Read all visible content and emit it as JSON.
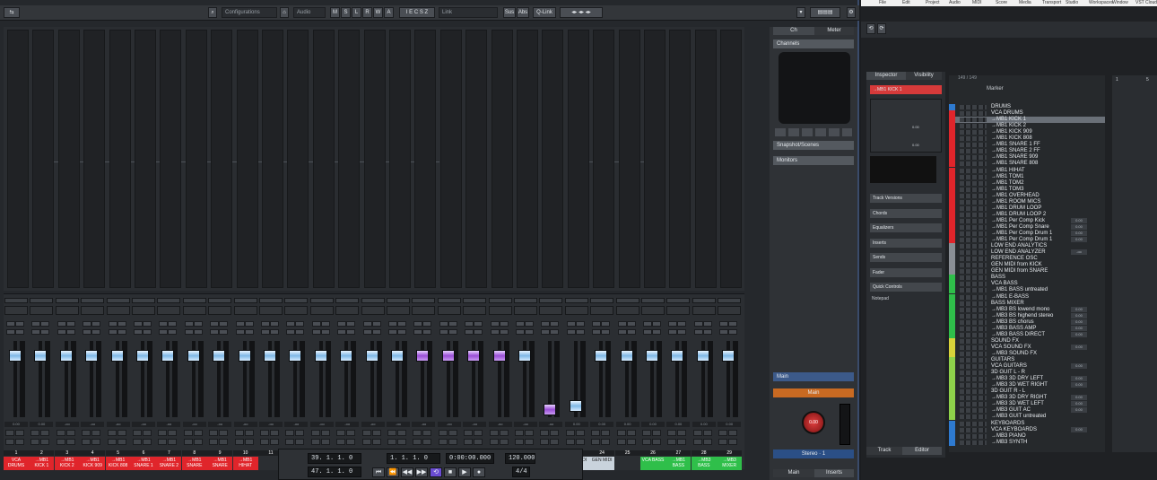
{
  "mixer": {
    "toolbar": {
      "config_label": "Configurations",
      "field_a": "Audio",
      "letters": [
        "M",
        "S",
        "L",
        "R",
        "W",
        "A"
      ],
      "field_b": "Link",
      "sus": "Sus",
      "abs": "Abs",
      "qlink": "Q-Link"
    },
    "right_panel": {
      "tab_ch": "Ch",
      "tab_meter": "Meter",
      "channel_label": "Channels",
      "snap_label": "Snapshot/Scenes",
      "monitors_label": "Monitors",
      "main_label": "Main",
      "main_value": "Main",
      "stereo": "Stereo",
      "stereo_value": "1",
      "knob_value": "0.00",
      "bottom_tab_main": "Main",
      "bottom_tab_inserts": "Inserts"
    },
    "strips": [
      {
        "num": "1",
        "name": "VCA DRUMS",
        "color": "#e0252b",
        "val": "0.00",
        "cap": "blue"
      },
      {
        "num": "2",
        "name": "→MB1 KICK 1",
        "color": "#e0252b",
        "val": "0.00",
        "cap": "blue"
      },
      {
        "num": "3",
        "name": "→MB1 KICK 2",
        "color": "#e0252b",
        "val": "-oo",
        "cap": "blue"
      },
      {
        "num": "4",
        "name": "→MB1 KICK 909",
        "color": "#e0252b",
        "val": "-oo",
        "cap": "blue"
      },
      {
        "num": "5",
        "name": "→MB1 KICK 808",
        "color": "#e0252b",
        "val": "-oo",
        "cap": "blue"
      },
      {
        "num": "6",
        "name": "→MB1 SNARE 1",
        "color": "#e0252b",
        "val": "-oo",
        "cap": "blue"
      },
      {
        "num": "7",
        "name": "→MB1 SNARE 2",
        "color": "#e0252b",
        "val": "-oo",
        "cap": "blue"
      },
      {
        "num": "8",
        "name": "→MB1 SNARE",
        "color": "#e0252b",
        "val": "-oo",
        "cap": "blue"
      },
      {
        "num": "9",
        "name": "→MB1 SNARE",
        "color": "#e0252b",
        "val": "-oo",
        "cap": "blue"
      },
      {
        "num": "10",
        "name": "→MB1 HIHAT",
        "color": "#e0252b",
        "val": "-oo",
        "cap": "blue"
      },
      {
        "num": "11",
        "name": "",
        "color": "#2b2e32",
        "val": "-oo",
        "cap": "blue"
      },
      {
        "num": "",
        "name": "",
        "color": "#2b2e32",
        "val": "-oo",
        "cap": "blue"
      },
      {
        "num": "",
        "name": "",
        "color": "#2b2e32",
        "val": "-oo",
        "cap": "blue"
      },
      {
        "num": "",
        "name": "",
        "color": "#2b2e32",
        "val": "-oo",
        "cap": "blue"
      },
      {
        "num": "",
        "name": "",
        "color": "#2b2e32",
        "val": "-oo",
        "cap": "blue"
      },
      {
        "num": "",
        "name": "",
        "color": "#2b2e32",
        "val": "-oo",
        "cap": "blue"
      },
      {
        "num": "",
        "name": "",
        "color": "#2b2e32",
        "val": "-oo",
        "cap": "purple"
      },
      {
        "num": "",
        "name": "",
        "color": "#2b2e32",
        "val": "-oo",
        "cap": "purple"
      },
      {
        "num": "",
        "name": "",
        "color": "#2b2e32",
        "val": "-oo",
        "cap": "purple"
      },
      {
        "num": "",
        "name": "",
        "color": "#2b2e32",
        "val": "-oo",
        "cap": "purple"
      },
      {
        "num": "",
        "name": "",
        "color": "#2b2e32",
        "val": "-oo",
        "cap": "blue"
      },
      {
        "num": "",
        "name": "",
        "color": "#2b2e32",
        "val": "-oo",
        "cap": "purple"
      },
      {
        "num": "",
        "name": "GEN MIDI",
        "color": "#c9d3dc",
        "val": "0.00",
        "cap": "blue"
      },
      {
        "num": "24",
        "name": "GEN MIDI",
        "color": "#c9d3dc",
        "val": "0.00",
        "cap": "blue"
      },
      {
        "num": "25",
        "name": "",
        "color": "#2b2e32",
        "val": "0.00",
        "cap": "blue"
      },
      {
        "num": "26",
        "name": "VCA BASS",
        "color": "#2fbf4a",
        "val": "0.00",
        "cap": "blue"
      },
      {
        "num": "27",
        "name": "→MB1 BASS",
        "color": "#2fbf4a",
        "val": "0.00",
        "cap": "blue"
      },
      {
        "num": "28",
        "name": "→MB3 BASS",
        "color": "#2fbf4a",
        "val": "0.00",
        "cap": "blue"
      },
      {
        "num": "29",
        "name": "→MB3 MIXER",
        "color": "#2fbf4a",
        "val": "0.00",
        "cap": "blue"
      }
    ],
    "transport": {
      "pos1": "39. 1. 1. 0",
      "pos2": "47. 1. 1. 0",
      "pos3": "1. 1. 1. 0",
      "time": "0:00:00.000",
      "tempo": "120.000",
      "sig": "4/4"
    }
  },
  "project": {
    "menu": [
      "File",
      "Edit",
      "Project",
      "Audio",
      "MIDI",
      "Score",
      "Media",
      "Transport",
      "Studio",
      "Workspaces",
      "Window",
      "VST Cloud"
    ],
    "inspector": {
      "tab_inspector": "Inspector",
      "tab_visibility": "Visibility",
      "track_name": "→MB1 KICK 1",
      "sections": [
        "Track Versions",
        "Chords",
        "Equalizers",
        "Inserts",
        "Sends",
        "Fader",
        "Quick Controls"
      ],
      "notepad": "Notepad",
      "value1": "0.00",
      "value2": "0.00",
      "tab_track": "Track",
      "tab_editor": "Editor"
    },
    "tracklist": {
      "counter": "149 / 149",
      "marker": "Marker",
      "tracks": [
        {
          "name": "DRUMS",
          "color": "#2e7ad0",
          "v": ""
        },
        {
          "name": "VCA DRUMS",
          "color": "#e0252b",
          "v": ""
        },
        {
          "name": "→MB1 KICK 1",
          "color": "#e0252b",
          "v": ""
        },
        {
          "name": "→MB1 KICK 2",
          "color": "#e0252b",
          "v": ""
        },
        {
          "name": "→MB1 KICK 909",
          "color": "#e0252b",
          "v": ""
        },
        {
          "name": "→MB1 KICK 808",
          "color": "#e0252b",
          "v": ""
        },
        {
          "name": "→MB1 SNARE 1 FF",
          "color": "#e0252b",
          "v": ""
        },
        {
          "name": "→MB1 SNARE 2 FF",
          "color": "#e0252b",
          "v": ""
        },
        {
          "name": "→MB1 SNARE 909",
          "color": "#e0252b",
          "v": ""
        },
        {
          "name": "→MB1 SNARE 808",
          "color": "#e0252b",
          "v": ""
        },
        {
          "name": "→MB1 HIHAT",
          "color": "#e0252b",
          "v": ""
        },
        {
          "name": "→MB1 TOM1",
          "color": "#e0252b",
          "v": ""
        },
        {
          "name": "→MB1 TOM2",
          "color": "#e0252b",
          "v": ""
        },
        {
          "name": "→MB1 TOM3",
          "color": "#e0252b",
          "v": ""
        },
        {
          "name": "→MB1 OVERHEAD",
          "color": "#e0252b",
          "v": ""
        },
        {
          "name": "→MB1 ROOM MICS",
          "color": "#e0252b",
          "v": ""
        },
        {
          "name": "→MB1 DRUM LOOP",
          "color": "#e0252b",
          "v": ""
        },
        {
          "name": "→MB1 DRUM LOOP 2",
          "color": "#e0252b",
          "v": ""
        },
        {
          "name": "→MB1 Per Comp Kick",
          "color": "#e0252b",
          "v": "0.00"
        },
        {
          "name": "→MB1 Per Comp Snare",
          "color": "#e0252b",
          "v": "0.00"
        },
        {
          "name": "→MB1 Per Comp Drum 1",
          "color": "#e0252b",
          "v": "0.00"
        },
        {
          "name": "→MB1 Per Comp Drum 1",
          "color": "#e0252b",
          "v": "0.00"
        },
        {
          "name": "LOW END ANALYTICS",
          "color": "#8a8f95",
          "v": ""
        },
        {
          "name": "LOW END ANALYZER",
          "color": "#8a8f95",
          "v": "-oo"
        },
        {
          "name": "REFERENCE OSC",
          "color": "#8a8f95",
          "v": ""
        },
        {
          "name": "GEN MIDI from KICK",
          "color": "#8a8f95",
          "v": ""
        },
        {
          "name": "GEN MIDI from SNARE",
          "color": "#8a8f95",
          "v": ""
        },
        {
          "name": "BASS",
          "color": "#2fbf4a",
          "v": ""
        },
        {
          "name": "VCA BASS",
          "color": "#2fbf4a",
          "v": ""
        },
        {
          "name": "→MB1 BASS untreated",
          "color": "#2fbf4a",
          "v": ""
        },
        {
          "name": "→MB1 E-BASS",
          "color": "#2fbf4a",
          "v": ""
        },
        {
          "name": "BASS MIXER",
          "color": "#2fbf4a",
          "v": ""
        },
        {
          "name": "→MB3 BS lowend mono",
          "color": "#2fbf4a",
          "v": "0.00"
        },
        {
          "name": "→MB3 BS highend stereo",
          "color": "#2fbf4a",
          "v": "0.00"
        },
        {
          "name": "→MB3 BS chorus",
          "color": "#2fbf4a",
          "v": "0.00"
        },
        {
          "name": "→MB3 BASS AMP",
          "color": "#2fbf4a",
          "v": "0.00"
        },
        {
          "name": "→MB3 BASS DIRECT",
          "color": "#2fbf4a",
          "v": "0.00"
        },
        {
          "name": "SOUND FX",
          "color": "#d8d33a",
          "v": ""
        },
        {
          "name": "VCA SOUND FX",
          "color": "#d8d33a",
          "v": "0.00"
        },
        {
          "name": "→MB3 SOUND FX",
          "color": "#d8d33a",
          "v": ""
        },
        {
          "name": "GUITARS",
          "color": "#8ed24a",
          "v": ""
        },
        {
          "name": "VCA GUITARS",
          "color": "#8ed24a",
          "v": "0.00"
        },
        {
          "name": "3D GUIT L - R",
          "color": "#8ed24a",
          "v": ""
        },
        {
          "name": "→MB3 3D DRY LEFT",
          "color": "#8ed24a",
          "v": "0.00"
        },
        {
          "name": "→MB3 3D WET RIGHT",
          "color": "#8ed24a",
          "v": "0.00"
        },
        {
          "name": "3D GUIT R - L",
          "color": "#8ed24a",
          "v": ""
        },
        {
          "name": "→MB3 3D DRY RIGHT",
          "color": "#8ed24a",
          "v": "0.00"
        },
        {
          "name": "→MB3 3D WET LEFT",
          "color": "#8ed24a",
          "v": "0.00"
        },
        {
          "name": "→MB3 GUIT AC",
          "color": "#8ed24a",
          "v": "0.00"
        },
        {
          "name": "→MB3 GUIT untreated",
          "color": "#8ed24a",
          "v": ""
        },
        {
          "name": "KEYBOARDS",
          "color": "#2e7ad0",
          "v": ""
        },
        {
          "name": "VCA KEYBOARDS",
          "color": "#2e7ad0",
          "v": "0.00"
        },
        {
          "name": "→MB3 PIANO",
          "color": "#2e7ad0",
          "v": ""
        },
        {
          "name": "→MB3 SYNTH",
          "color": "#2e7ad0",
          "v": ""
        }
      ]
    },
    "ruler": [
      "1",
      "5"
    ]
  }
}
